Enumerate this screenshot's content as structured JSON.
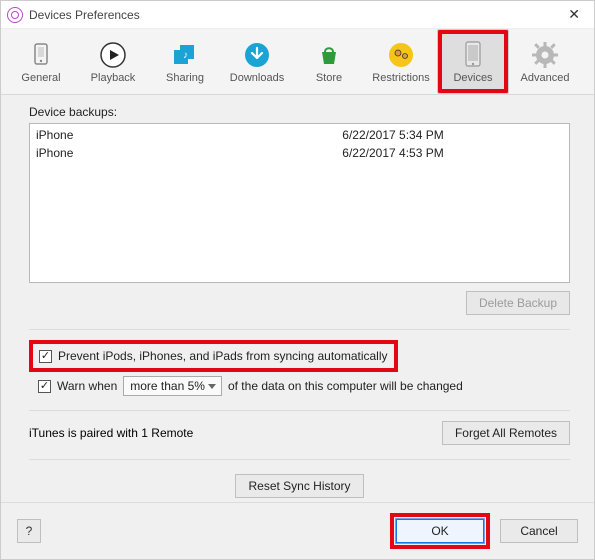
{
  "window": {
    "title": "Devices Preferences"
  },
  "toolbar": {
    "items": [
      {
        "label": "General"
      },
      {
        "label": "Playback"
      },
      {
        "label": "Sharing"
      },
      {
        "label": "Downloads"
      },
      {
        "label": "Store"
      },
      {
        "label": "Restrictions"
      },
      {
        "label": "Devices"
      },
      {
        "label": "Advanced"
      }
    ]
  },
  "backups": {
    "label": "Device backups:",
    "rows": [
      {
        "name": "iPhone",
        "date": "6/22/2017 5:34 PM"
      },
      {
        "name": "iPhone",
        "date": "6/22/2017 4:53 PM"
      }
    ],
    "delete_label": "Delete Backup"
  },
  "options": {
    "prevent_sync_label": "Prevent iPods, iPhones, and iPads from syncing automatically",
    "warn_label_pre": "Warn when",
    "warn_select": "more than 5%",
    "warn_label_post": "of the data on this computer will be changed"
  },
  "remotes": {
    "status": "iTunes is paired with 1 Remote",
    "forget_label": "Forget All Remotes"
  },
  "reset_label": "Reset Sync History",
  "footer": {
    "help": "?",
    "ok": "OK",
    "cancel": "Cancel"
  }
}
